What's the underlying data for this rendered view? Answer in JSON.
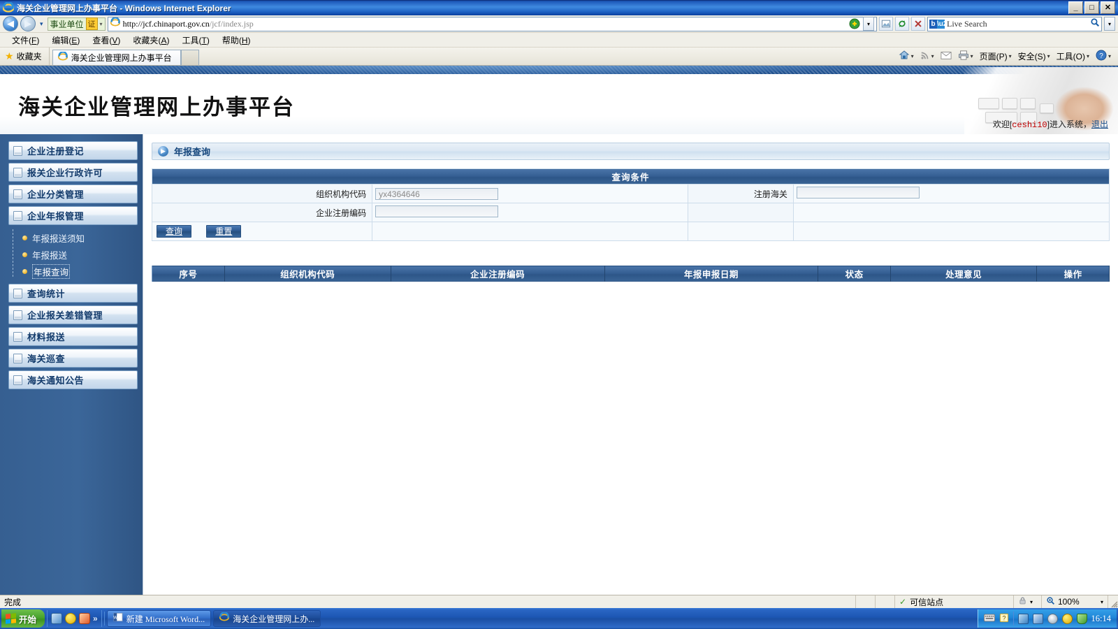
{
  "window": {
    "title": "海关企业管理网上办事平台 - Windows Internet Explorer",
    "minimize": "_",
    "maximize": "□",
    "close": "✕"
  },
  "navigation": {
    "back": "◀",
    "forward": "▶",
    "history_caret": "▾",
    "cert_pill_label": "事业单位",
    "cert_badge": "证",
    "cert_caret": "▾",
    "url_main": "http://jcf.chinaport.gov.cn",
    "url_path": "/jcf/index.jsp",
    "refresh": "↻",
    "stop": "✕",
    "compat": "▤",
    "go_caret": "▾",
    "search_placeholder": "Live Search",
    "search_value": "Live Search",
    "search_icon": "⌕",
    "search_caret": "▾"
  },
  "menubar": [
    {
      "label": "文件",
      "accel": "F"
    },
    {
      "label": "编辑",
      "accel": "E"
    },
    {
      "label": "查看",
      "accel": "V"
    },
    {
      "label": "收藏夹",
      "accel": "A"
    },
    {
      "label": "工具",
      "accel": "T"
    },
    {
      "label": "帮助",
      "accel": "H"
    }
  ],
  "favbar": {
    "favorites_label": "收藏夹",
    "tab_label": "海关企业管理网上办事平台",
    "new_tab_label": ""
  },
  "commandbar": [
    {
      "label": "",
      "icon": "home-icon",
      "caret": "▾"
    },
    {
      "label": "",
      "icon": "feeds-icon",
      "caret": "▾"
    },
    {
      "label": "",
      "icon": "mail-icon",
      "caret": ""
    },
    {
      "label": "",
      "icon": "print-icon",
      "caret": "▾"
    },
    {
      "label": "页面(P)",
      "icon": "",
      "caret": "▾"
    },
    {
      "label": "安全(S)",
      "icon": "",
      "caret": "▾"
    },
    {
      "label": "工具(O)",
      "icon": "",
      "caret": "▾"
    },
    {
      "label": "",
      "icon": "help-icon",
      "caret": "▾"
    }
  ],
  "banner": {
    "site_title": "海关企业管理网上办事平台",
    "welcome_prefix": "欢迎[",
    "welcome_user": "ceshi10",
    "welcome_suffix": "]进入系统，",
    "logout_label": "退出"
  },
  "sidebar": {
    "items": [
      {
        "label": "企业注册登记",
        "icon": "document-icon"
      },
      {
        "label": "报关企业行政许可",
        "icon": "document-icon"
      },
      {
        "label": "企业分类管理",
        "icon": "document-icon"
      },
      {
        "label": "企业年报管理",
        "icon": "document-icon"
      },
      {
        "label": "查询统计",
        "icon": "document-icon"
      },
      {
        "label": "企业报关差错管理",
        "icon": "document-icon"
      },
      {
        "label": "材料报送",
        "icon": "document-icon"
      },
      {
        "label": "海关巡查",
        "icon": "document-icon"
      },
      {
        "label": "海关通知公告",
        "icon": "document-icon"
      }
    ],
    "submenu": [
      {
        "label": "年报报送须知",
        "active": false
      },
      {
        "label": "年报报送",
        "active": false
      },
      {
        "label": "年报查询",
        "active": true
      }
    ]
  },
  "main": {
    "panel_title": "年报查询",
    "panel_arrow_icon": "▶",
    "query_caption": "查询条件",
    "fields": {
      "org_code_label": "组织机构代码",
      "org_code_value": "yx4364646",
      "customs_label": "注册海关",
      "customs_value": "",
      "reg_code_label": "企业注册编码",
      "reg_code_value": ""
    },
    "buttons": {
      "query": "查询",
      "reset": "重置"
    },
    "results": {
      "columns": [
        "序号",
        "组织机构代码",
        "企业注册编码",
        "年报申报日期",
        "状态",
        "处理意见",
        "操作"
      ],
      "rows": []
    }
  },
  "statusbar": {
    "message": "完成",
    "zone_check": "✓",
    "zone_label": "可信站点",
    "protect_icon": "⚿",
    "protect_caret": "▾",
    "zoom_icon": "⌕",
    "zoom_label": "100%",
    "zoom_caret": "▾"
  },
  "taskbar": {
    "start_label": "开始",
    "quicklaunch_chevron": "»",
    "tasks": [
      {
        "label": "新建 Microsoft Word...",
        "icon": "word-icon",
        "active": false
      },
      {
        "label": "海关企业管理网上办...",
        "icon": "ie-icon",
        "active": true
      }
    ],
    "tray": {
      "keyboard_icon": "⌨",
      "help_icon": "?",
      "clock": "16:14"
    }
  },
  "colors": {
    "accent_blue": "#2d5688",
    "sidebar_blue": "#365f91",
    "title_blue": "#1c57b8",
    "user_red": "#c00000",
    "link_blue": "#1a4f8a"
  }
}
